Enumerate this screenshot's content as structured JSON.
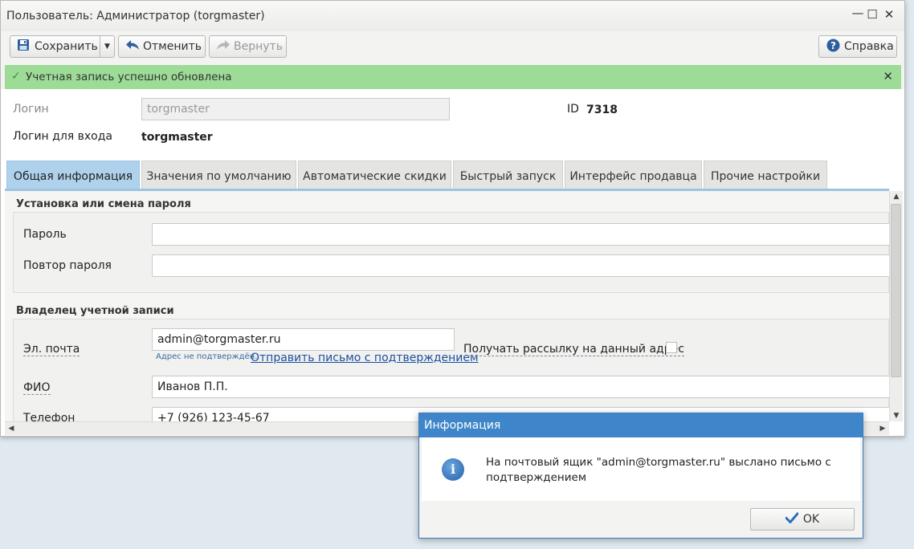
{
  "window": {
    "title": "Пользователь: Администратор (torgmaster)"
  },
  "window_controls": {
    "minimize": "—",
    "maximize": "☐",
    "close": "✕"
  },
  "toolbar": {
    "save_label": "Сохранить",
    "cancel_label": "Отменить",
    "redo_label": "Вернуть",
    "help_label": "Справка"
  },
  "banner": {
    "message": "Учетная запись успешно обновлена",
    "close": "✕"
  },
  "account": {
    "login_label": "Логин",
    "login_value": "torgmaster",
    "id_label": "ID",
    "id_value": "7318",
    "signin_label": "Логин для входа",
    "signin_value": "torgmaster"
  },
  "tabs": [
    {
      "label": "Общая информация",
      "active": true
    },
    {
      "label": "Значения по умолчанию"
    },
    {
      "label": "Автоматические скидки"
    },
    {
      "label": "Быстрый запуск"
    },
    {
      "label": "Интерфейс продавца"
    },
    {
      "label": "Прочие настройки"
    }
  ],
  "password_section": {
    "heading": "Установка или смена пароля",
    "password_label": "Пароль",
    "password_value": "",
    "repeat_label": "Повтор пароля",
    "repeat_value": ""
  },
  "owner_section": {
    "heading": "Владелец учетной записи",
    "email_label": "Эл. почта",
    "email_value": "admin@torgmaster.ru",
    "email_note": "Адрес не подтверждён.",
    "send_confirm_link": "Отправить письмо с подтверждением",
    "subscribe_label": "Получать рассылку на данный адрес",
    "subscribe_checked": false,
    "name_label": "ФИО",
    "name_value": "Иванов П.П.",
    "phone_label": "Телефон",
    "phone_value": "+7 (926) 123-45-67"
  },
  "dialog": {
    "title": "Информация",
    "message": "На почтовый ящик \"admin@torgmaster.ru\" выслано письмо с подтверждением",
    "ok_label": "OK"
  },
  "colors": {
    "banner_bg": "#9ddc96",
    "active_tab": "#aed2ec",
    "dialog_title": "#3e86c9",
    "link": "#1a4fa0"
  },
  "icons": [
    "save-icon",
    "dropdown-arrow-icon",
    "undo-icon",
    "redo-icon",
    "help-icon",
    "success-check-icon",
    "info-icon",
    "ok-check-icon"
  ]
}
